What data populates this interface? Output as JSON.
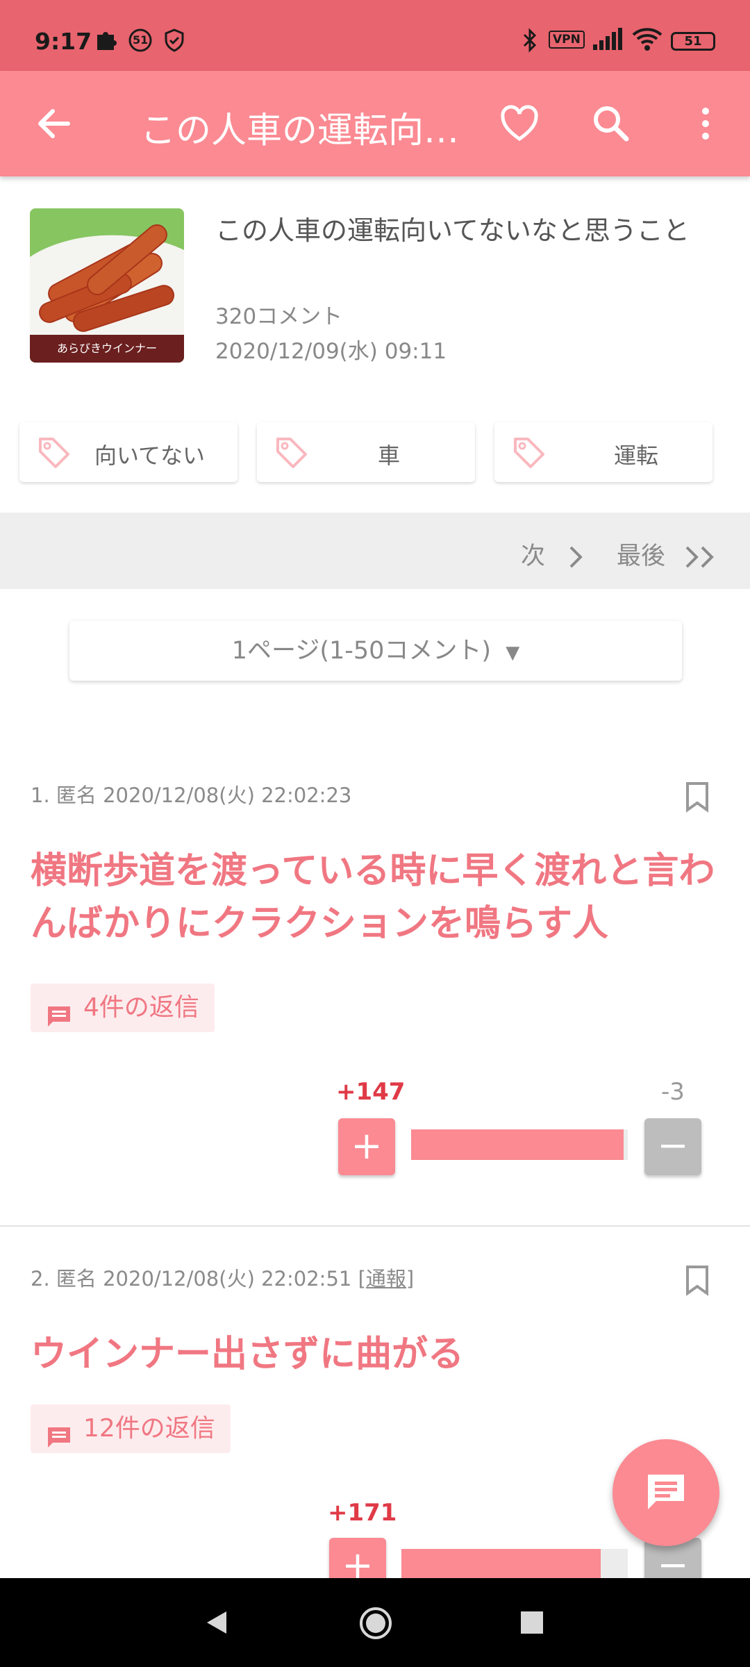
{
  "status_bar": {
    "time": "9:17",
    "notif_count": "51",
    "vpn": "VPN",
    "battery": "51"
  },
  "app_bar": {
    "title": "この人車の運転向いてないなと思うこと"
  },
  "topic": {
    "title": "この人車の運転向いてないなと思うこと",
    "comment_count": "320コメント",
    "date": "2020/12/09(水) 09:11",
    "thumb_label": "あらびきウインナー"
  },
  "tags": [
    "向いてない",
    "車",
    "運転"
  ],
  "pager": {
    "next_label": "次",
    "last_label": "最後"
  },
  "page_select": {
    "label": "1ページ(1-50コメント)",
    "arrow": "▼"
  },
  "comments": [
    {
      "meta": "1. 匿名 2020/12/08(火) 22:02:23",
      "report": "",
      "body": "横断歩道を渡っている時に早く渡れと言わんばかりにクラクションを鳴らす人",
      "reply_label": "4件の返信",
      "plus": "+147",
      "minus": "-3",
      "plus_ratio": 0.98
    },
    {
      "meta": "2. 匿名 2020/12/08(火) 22:02:51",
      "report": "[通報]",
      "body": "ウインナー出さずに曲がる",
      "reply_label": "12件の返信",
      "plus": "+171",
      "minus": "",
      "plus_ratio": 0.88
    }
  ],
  "buttons": {
    "plus_symbol": "+",
    "minus_symbol": "−"
  },
  "colors": {
    "accent": "#fb8a92",
    "status_bar": "#e8646e",
    "comment_text": "#f07782",
    "plus_count": "#e03a47"
  }
}
